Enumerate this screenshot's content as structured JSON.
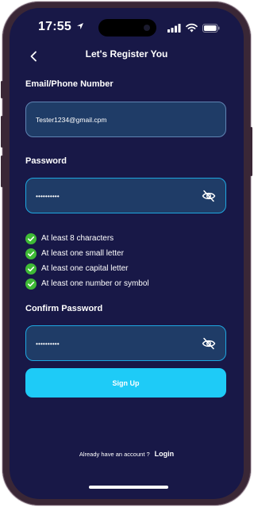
{
  "status_bar": {
    "time": "17:55",
    "icons": [
      "location-arrow-icon",
      "cellular-signal-icon",
      "wifi-icon",
      "battery-icon"
    ]
  },
  "header": {
    "back_icon": "chevron-left-icon",
    "title": "Let's Register You"
  },
  "form": {
    "email": {
      "label": "Email/Phone Number",
      "value": "Tester1234@gmail.cpm"
    },
    "password": {
      "label": "Password",
      "value": "••••••••••",
      "visibility_icon": "eye-off-icon"
    },
    "rules": [
      {
        "text": "At least 8 characters",
        "met": true
      },
      {
        "text": "At least one small letter",
        "met": true
      },
      {
        "text": "At least one capital letter",
        "met": true
      },
      {
        "text": "At least one number or symbol",
        "met": true
      }
    ],
    "confirm_password": {
      "label": "Confirm Password",
      "value": "••••••••••",
      "visibility_icon": "eye-off-icon"
    },
    "submit_label": "Sign Up"
  },
  "footer": {
    "prompt": "Already have an account ?",
    "login_label": "Login"
  },
  "colors": {
    "background": "#181847",
    "field_fill": "#1f3c67",
    "field_active_border": "#1ea7e0",
    "button": "#1ecbf7",
    "check": "#3fba36"
  }
}
